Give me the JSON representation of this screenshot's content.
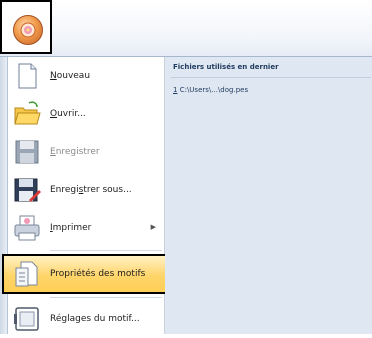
{
  "app_button": {
    "icon": "embroidery-app-icon"
  },
  "menu": {
    "items": [
      {
        "label": "Nouveau",
        "accel": "N",
        "icon": "new-document-icon",
        "enabled": true
      },
      {
        "label": "Ouvrir...",
        "accel": "O",
        "icon": "open-folder-icon",
        "enabled": true
      },
      {
        "label": "Enregistrer",
        "accel": "E",
        "icon": "save-icon",
        "enabled": false
      },
      {
        "label": "Enregistrer sous...",
        "accel": "s",
        "icon": "save-as-icon",
        "enabled": true
      },
      {
        "label": "Imprimer",
        "accel": "I",
        "icon": "print-icon",
        "enabled": true,
        "submenu": true
      },
      {
        "label": "Propriétés des motifs",
        "icon": "design-properties-icon",
        "enabled": true,
        "highlighted": true
      },
      {
        "label": "Réglages du motif...",
        "icon": "design-settings-icon",
        "enabled": true
      }
    ]
  },
  "recent": {
    "header": "Fichiers utilisés en dernier",
    "items": [
      {
        "index": "1",
        "path": "C:\\Users\\...\\dog.pes"
      }
    ]
  },
  "colors": {
    "highlight": "#ffd56b",
    "panel": "#dfe7f2",
    "accent_text": "#1e3a5e"
  }
}
